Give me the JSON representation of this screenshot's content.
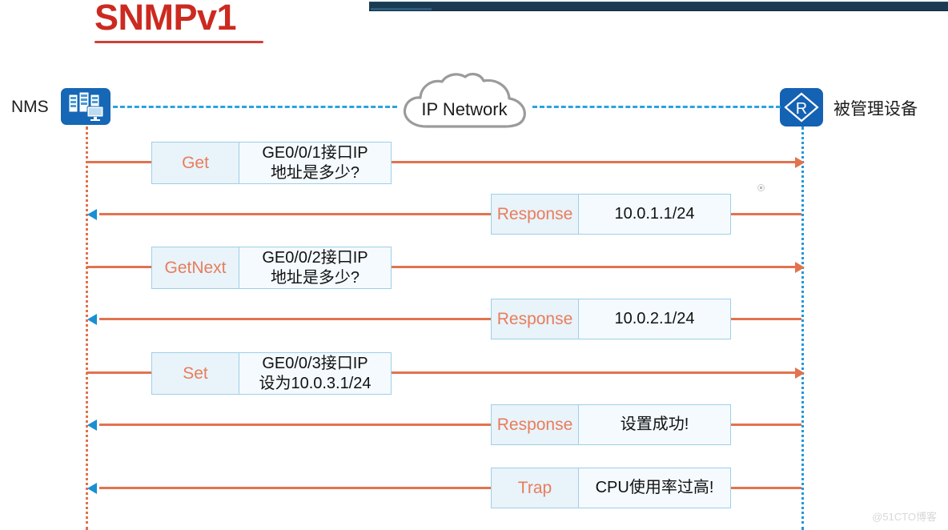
{
  "title": "SNMPv1",
  "top_bar": {
    "color": "#1b3b52"
  },
  "endpoints": {
    "left": {
      "label": "NMS",
      "icon": "server-rack-icon"
    },
    "right": {
      "label": "被管理设备",
      "icon": "router-icon"
    }
  },
  "network": {
    "label": "IP Network",
    "icon": "cloud-icon"
  },
  "colors": {
    "title": "#cc2a20",
    "request_line": "#e2734f",
    "response_line": "#1a8fd1",
    "box_border": "#9ecfe8",
    "box_fill": "#f4fafd",
    "tag_fill": "#e9f3fa",
    "tag_text": "#e87d5c",
    "dashed_link": "#2ba3e0",
    "nms_lifeline": "#e2714c",
    "device_lifeline": "#2196d8"
  },
  "messages": [
    {
      "tag": "Get",
      "lines": [
        "GE0/0/1接口IP",
        "地址是多少?"
      ],
      "direction": "nms-to-device",
      "kind": "request"
    },
    {
      "tag": "Response",
      "lines": [
        "10.0.1.1/24"
      ],
      "direction": "device-to-nms",
      "kind": "response"
    },
    {
      "tag": "GetNext",
      "lines": [
        "GE0/0/2接口IP",
        "地址是多少?"
      ],
      "direction": "nms-to-device",
      "kind": "request"
    },
    {
      "tag": "Response",
      "lines": [
        "10.0.2.1/24"
      ],
      "direction": "device-to-nms",
      "kind": "response"
    },
    {
      "tag": "Set",
      "lines": [
        "GE0/0/3接口IP",
        "设为10.0.3.1/24"
      ],
      "direction": "nms-to-device",
      "kind": "request"
    },
    {
      "tag": "Response",
      "lines": [
        "设置成功!"
      ],
      "direction": "device-to-nms",
      "kind": "response"
    },
    {
      "tag": "Trap",
      "lines": [
        "CPU使用率过高!"
      ],
      "direction": "device-to-nms",
      "kind": "response"
    }
  ],
  "watermark": "@51CTO博客"
}
